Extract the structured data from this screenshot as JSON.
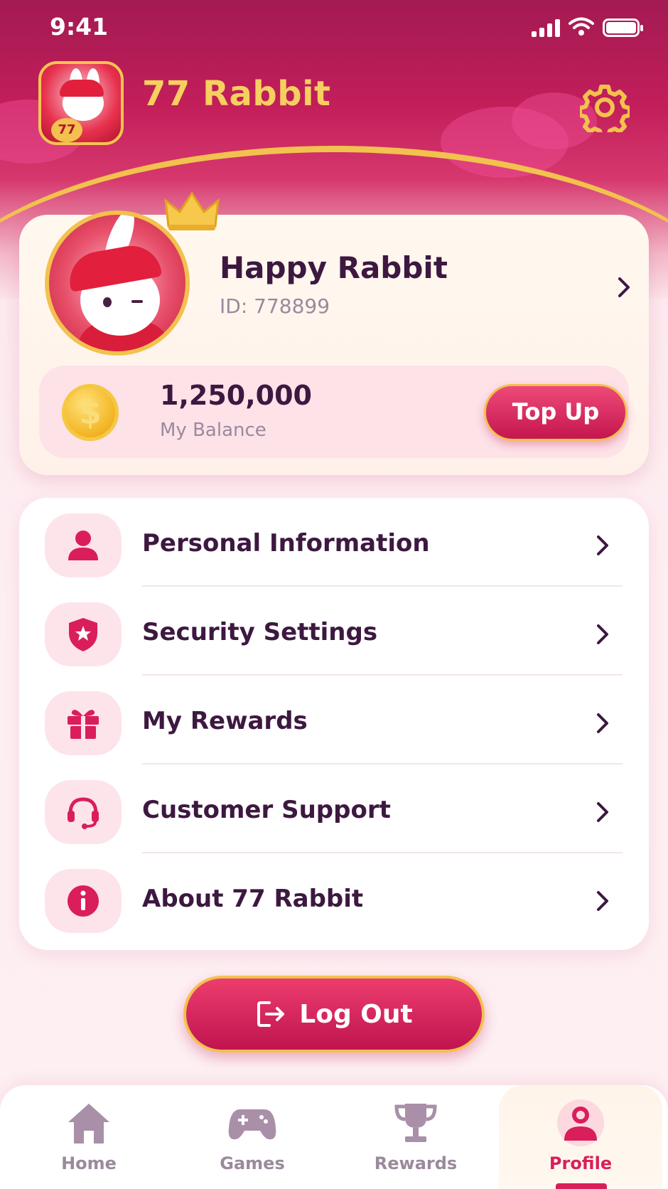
{
  "status_bar": {
    "time": "9:41"
  },
  "header": {
    "app_name": "77 Rabbit",
    "logo_text": "77"
  },
  "profile": {
    "name": "Happy Rabbit",
    "id_text": "ID: 778899",
    "balance_amount": "1,250,000",
    "balance_label": "My Balance",
    "topup_label": "Top Up"
  },
  "menu": {
    "items": [
      {
        "label": "Personal Information",
        "icon": "person-icon"
      },
      {
        "label": "Security Settings",
        "icon": "shield-star-icon"
      },
      {
        "label": "My Rewards",
        "icon": "gift-icon"
      },
      {
        "label": "Customer Support",
        "icon": "headset-icon"
      },
      {
        "label": "About 77 Rabbit",
        "icon": "info-icon"
      }
    ]
  },
  "logout": {
    "label": "Log Out"
  },
  "bottom_nav": {
    "items": [
      {
        "label": "Home",
        "icon": "home-icon"
      },
      {
        "label": "Games",
        "icon": "gamepad-icon"
      },
      {
        "label": "Rewards",
        "icon": "trophy-icon"
      },
      {
        "label": "Profile",
        "icon": "user-icon",
        "active": true
      }
    ]
  },
  "colors": {
    "primary": "#c4164f",
    "gold": "#f2c14e",
    "text_dark": "#3d1840",
    "text_muted": "#9a8a9c",
    "icon_bg": "#fde4ea"
  }
}
